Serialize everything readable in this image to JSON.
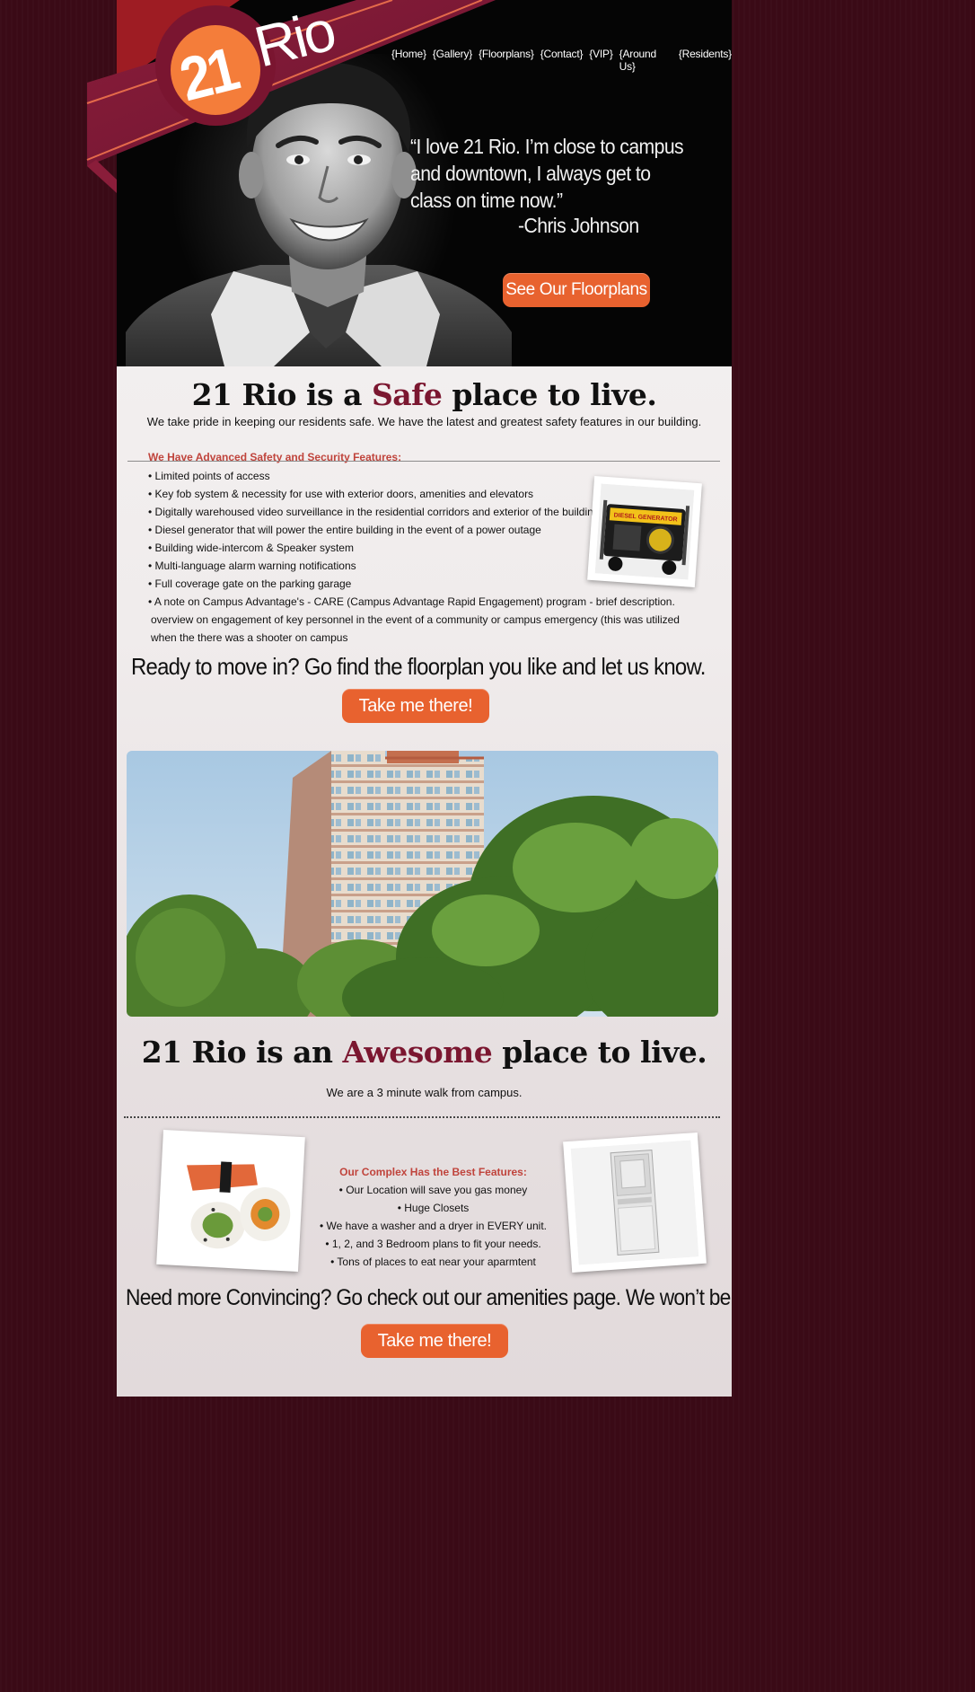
{
  "logo": {
    "number": "21",
    "name": "Rio"
  },
  "nav": {
    "items": [
      "{Home}",
      "{Gallery}",
      "{Floorplans}",
      "{Contact}",
      "{VIP}",
      "{Around Us}",
      "{Residents}"
    ]
  },
  "hero": {
    "quote": "“I love 21 Rio.  I’m close to campus\n and downtown, I always get to\nclass on time now.”",
    "author": "-Chris Johnson",
    "cta_label": "See Our Floorplans"
  },
  "safe_section": {
    "title_prefix": "21 Rio is a ",
    "title_accent": "Safe",
    "title_suffix": " place to live.",
    "subtitle": "We take pride in keeping our residents safe.  We have the latest and greatest safety features in our building.",
    "features_heading": "We Have Advanced Safety and Security Features:",
    "features": [
      "• Limited points of access",
      "• Key fob system & necessity for use with exterior doors, amenities and elevators",
      "• Digitally warehoused video surveillance in the residential corridors and exterior of the building",
      "• Diesel generator that will power the entire building in the event of a power outage",
      "• Building wide-intercom & Speaker system",
      "• Multi-language alarm warning notifications",
      "• Full coverage gate on the parking garage",
      "• A note on Campus Advantage's - CARE (Campus Advantage Rapid Engagement) program - brief description. overview on engagement of key personnel in the event of a community or campus emergency (this was utilized when the there was a shooter on campus"
    ],
    "photo_icon": "diesel-generator-photo",
    "generator_label": "DIESEL GENERATOR",
    "ready_text": "Ready to move in?  Go find the floorplan you like and let us know.",
    "cta_label": "Take me there!"
  },
  "awesome_section": {
    "title_prefix": "21 Rio is an ",
    "title_accent": "Awesome",
    "title_suffix": " place to live.",
    "subtitle": "We are a 3 minute walk from campus.",
    "features_heading": "Our Complex Has the Best Features:",
    "features": [
      "• Our Location will save you gas money",
      "• Huge Closets",
      "• We have a washer and a dryer in EVERY unit.",
      "• 1, 2, and 3 Bedroom plans to fit your needs.",
      "• Tons of places to eat near your aparmtent"
    ],
    "convince_text": "Need more Convincing?  Go check out our amenities page.  We won’t be beaten.",
    "cta_label": "Take me there!"
  },
  "colors": {
    "brand_maroon": "#7b1730",
    "accent_orange": "#e8622f",
    "heading_red": "#c0443c",
    "page_background": "#3a0a16"
  }
}
